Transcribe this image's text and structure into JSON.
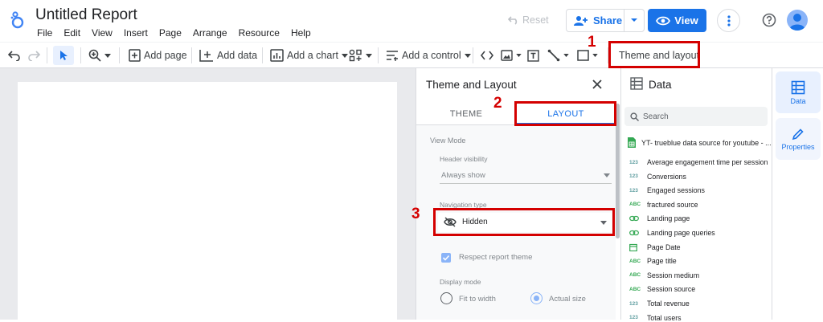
{
  "app": {
    "title": "Untitled Report",
    "menus": [
      "File",
      "Edit",
      "View",
      "Insert",
      "Page",
      "Arrange",
      "Resource",
      "Help"
    ],
    "reset_label": "Reset",
    "share_label": "Share",
    "view_label": "View"
  },
  "toolbar": {
    "add_page": "Add page",
    "add_data": "Add data",
    "add_chart": "Add a chart",
    "add_control": "Add a control",
    "theme_layout": "Theme and layout"
  },
  "theme_panel": {
    "title": "Theme and Layout",
    "tabs": [
      "THEME",
      "LAYOUT"
    ],
    "view_mode_label": "View Mode",
    "header_visibility_label": "Header visibility",
    "header_visibility_value": "Always show",
    "navigation_type_label": "Navigation type",
    "navigation_type_value": "Hidden",
    "respect_theme_label": "Respect report theme",
    "display_mode_label": "Display mode",
    "display_options": [
      "Fit to width",
      "Actual size"
    ],
    "display_selected": "Actual size"
  },
  "annotations": [
    "1",
    "2",
    "3"
  ],
  "data_panel": {
    "title": "Data",
    "search_placeholder": "Search",
    "source_name": "YT- trueblue data source for youtube - ...",
    "fields": [
      {
        "type": "123",
        "name": "Average engagement time per session"
      },
      {
        "type": "123",
        "name": "Conversions"
      },
      {
        "type": "123",
        "name": "Engaged sessions"
      },
      {
        "type": "ABC",
        "name": "fractured source"
      },
      {
        "type": "link",
        "name": "Landing page"
      },
      {
        "type": "link",
        "name": "Landing page queries"
      },
      {
        "type": "date",
        "name": "Page Date"
      },
      {
        "type": "ABC",
        "name": "Page title"
      },
      {
        "type": "ABC",
        "name": "Session medium"
      },
      {
        "type": "ABC",
        "name": "Session source"
      },
      {
        "type": "123",
        "name": "Total revenue"
      },
      {
        "type": "123",
        "name": "Total users"
      }
    ]
  },
  "rail": {
    "data_label": "Data",
    "properties_label": "Properties"
  },
  "colors": {
    "accent": "#1a73e8",
    "annotation_red": "#d40000",
    "field_green": "#34a853"
  }
}
